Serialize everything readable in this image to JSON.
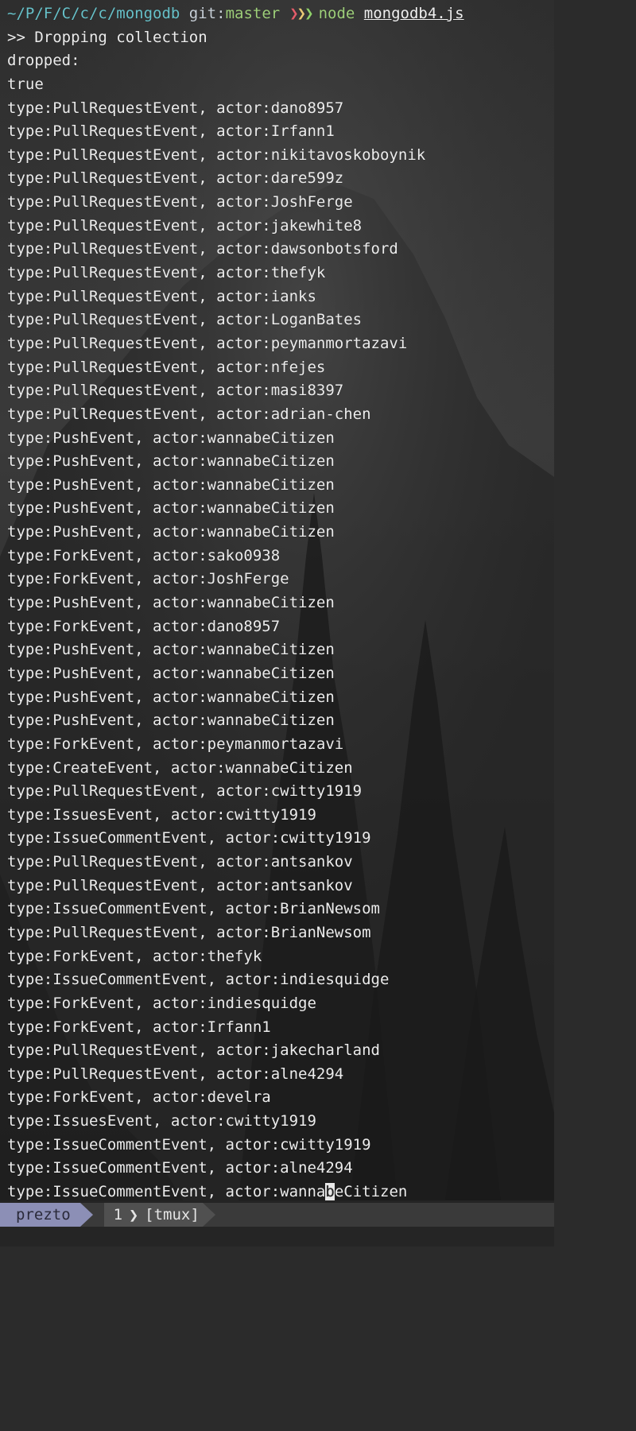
{
  "prompt": {
    "path": "~/P/F/C/c/c/mongodb",
    "git_label": "git",
    "git_sep": ":",
    "branch": "master",
    "arrows": "❯❯❯",
    "command": "node",
    "argument": "mongodb4.js"
  },
  "output": [
    ">> Dropping collection",
    "dropped:",
    "true",
    "type:PullRequestEvent, actor:dano8957",
    "type:PullRequestEvent, actor:Irfann1",
    "type:PullRequestEvent, actor:nikitavoskoboynik",
    "type:PullRequestEvent, actor:dare599z",
    "type:PullRequestEvent, actor:JoshFerge",
    "type:PullRequestEvent, actor:jakewhite8",
    "type:PullRequestEvent, actor:dawsonbotsford",
    "type:PullRequestEvent, actor:thefyk",
    "type:PullRequestEvent, actor:ianks",
    "type:PullRequestEvent, actor:LoganBates",
    "type:PullRequestEvent, actor:peymanmortazavi",
    "type:PullRequestEvent, actor:nfejes",
    "type:PullRequestEvent, actor:masi8397",
    "type:PullRequestEvent, actor:adrian-chen",
    "type:PushEvent, actor:wannabeCitizen",
    "type:PushEvent, actor:wannabeCitizen",
    "type:PushEvent, actor:wannabeCitizen",
    "type:PushEvent, actor:wannabeCitizen",
    "type:PushEvent, actor:wannabeCitizen",
    "type:ForkEvent, actor:sako0938",
    "type:ForkEvent, actor:JoshFerge",
    "type:PushEvent, actor:wannabeCitizen",
    "type:ForkEvent, actor:dano8957",
    "type:PushEvent, actor:wannabeCitizen",
    "type:PushEvent, actor:wannabeCitizen",
    "type:PushEvent, actor:wannabeCitizen",
    "type:PushEvent, actor:wannabeCitizen",
    "type:ForkEvent, actor:peymanmortazavi",
    "type:CreateEvent, actor:wannabeCitizen",
    "type:PullRequestEvent, actor:cwitty1919",
    "type:IssuesEvent, actor:cwitty1919",
    "type:IssueCommentEvent, actor:cwitty1919",
    "type:PullRequestEvent, actor:antsankov",
    "type:PullRequestEvent, actor:antsankov",
    "type:IssueCommentEvent, actor:BrianNewsom",
    "type:PullRequestEvent, actor:BrianNewsom",
    "type:ForkEvent, actor:thefyk",
    "type:IssueCommentEvent, actor:indiesquidge",
    "type:ForkEvent, actor:indiesquidge",
    "type:ForkEvent, actor:Irfann1",
    "type:PullRequestEvent, actor:jakecharland",
    "type:PullRequestEvent, actor:alne4294",
    "type:ForkEvent, actor:develra",
    "type:IssuesEvent, actor:cwitty1919",
    "type:IssueCommentEvent, actor:cwitty1919",
    "type:IssueCommentEvent, actor:alne4294"
  ],
  "last_line": {
    "before_cursor": "type:IssueCommentEvent, actor:wanna",
    "cursor_char": "b",
    "after_cursor": "eCitizen"
  },
  "statusbar": {
    "session_name": "prezto",
    "window_index": "1",
    "window_sep": "❯",
    "window_name": "[tmux]"
  },
  "colors": {
    "path": "#67c1c9",
    "branch": "#9ecf7a",
    "session_bg": "#8c8fb6",
    "window_bg": "#505050"
  }
}
